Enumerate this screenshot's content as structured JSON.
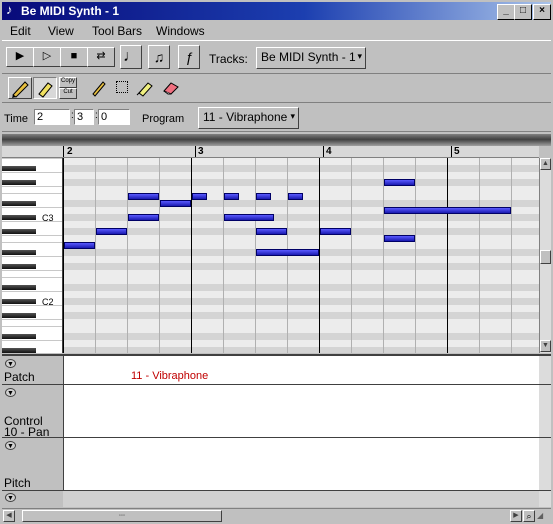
{
  "window": {
    "title": "Be MIDI Synth - 1",
    "min_glyph": "_",
    "max_glyph": "□",
    "close_glyph": "×"
  },
  "menu": {
    "items": [
      "Edit",
      "View",
      "Tool Bars",
      "Windows"
    ]
  },
  "toolbar": {
    "play_glyph": "▶",
    "play2_glyph": "▷",
    "stop_glyph": "■",
    "loop_glyph": "⇄",
    "metronome_glyph": "♩",
    "notes_glyph": "♫",
    "function_glyph": "ƒ",
    "tracks_label": "Tracks:",
    "tracks_value": "Be MIDI Synth - 1"
  },
  "tools": {
    "copy_label": "Copy",
    "cut_label": "Cut"
  },
  "position": {
    "time_label": "Time",
    "bar": "2",
    "beat": "3",
    "tick": "0",
    "program_label": "Program",
    "program_value": "11 - Vibraphone"
  },
  "ruler": {
    "marks": [
      "2",
      "3",
      "4",
      "5"
    ]
  },
  "keyboard": {
    "c3_label": "C3",
    "c2_label": "C2"
  },
  "lanes": {
    "patch_label": "Patch",
    "patch_event": "11 - Vibraphone",
    "control_label_line1": "Control",
    "control_label_line2": "10 - Pan",
    "pitch_label": "Pitch"
  },
  "colors": {
    "note": "#2a2ad0",
    "patch_event": "#c00000",
    "title_start": "#080a7a"
  },
  "notes": [
    {
      "bar": 2.0,
      "length": 0.25,
      "row": 12
    },
    {
      "bar": 2.25,
      "length": 0.25,
      "row": 10
    },
    {
      "bar": 2.5,
      "length": 0.25,
      "row": 8
    },
    {
      "bar": 2.5,
      "length": 0.25,
      "row": 5
    },
    {
      "bar": 2.75,
      "length": 0.25,
      "row": 6
    },
    {
      "bar": 3.0,
      "length": 0.125,
      "row": 5
    },
    {
      "bar": 3.25,
      "length": 0.125,
      "row": 5
    },
    {
      "bar": 3.25,
      "length": 0.4,
      "row": 8
    },
    {
      "bar": 3.5,
      "length": 0.125,
      "row": 5
    },
    {
      "bar": 3.75,
      "length": 0.125,
      "row": 5
    },
    {
      "bar": 3.5,
      "length": 0.25,
      "row": 10
    },
    {
      "bar": 3.5,
      "length": 0.5,
      "row": 13
    },
    {
      "bar": 4.0,
      "length": 0.25,
      "row": 10
    },
    {
      "bar": 4.5,
      "length": 0.25,
      "row": 3
    },
    {
      "bar": 4.5,
      "length": 1.0,
      "row": 7
    },
    {
      "bar": 4.5,
      "length": 0.25,
      "row": 11
    }
  ]
}
